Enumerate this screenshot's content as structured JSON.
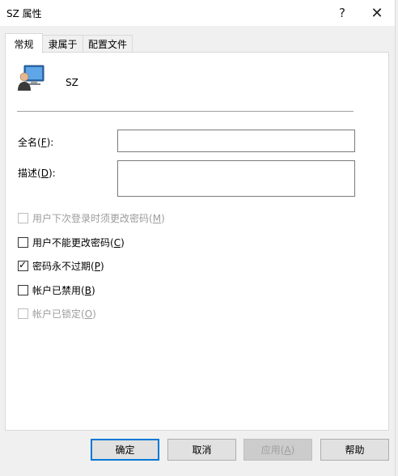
{
  "window": {
    "title": "SZ 属性",
    "help_glyph": "?",
    "close_glyph": "✕"
  },
  "tabs": [
    {
      "label": "常规",
      "active": true
    },
    {
      "label": "隶属于",
      "active": false
    },
    {
      "label": "配置文件",
      "active": false
    }
  ],
  "general": {
    "user_name": "SZ",
    "fullname_label": "全名",
    "fullname_key": "F",
    "fullname_value": "",
    "description_label": "描述",
    "description_key": "D",
    "description_value": "",
    "checkboxes": [
      {
        "label": "用户下次登录时须更改密码",
        "key": "M",
        "checked": false,
        "disabled": true
      },
      {
        "label": "用户不能更改密码",
        "key": "C",
        "checked": false,
        "disabled": false
      },
      {
        "label": "密码永不过期",
        "key": "P",
        "checked": true,
        "disabled": false
      },
      {
        "label": "帐户已禁用",
        "key": "B",
        "checked": false,
        "disabled": false
      },
      {
        "label": "帐户已锁定",
        "key": "O",
        "checked": false,
        "disabled": true
      }
    ]
  },
  "buttons": {
    "ok": "确定",
    "cancel": "取消",
    "apply": "应用",
    "apply_key": "A",
    "help": "帮助"
  }
}
